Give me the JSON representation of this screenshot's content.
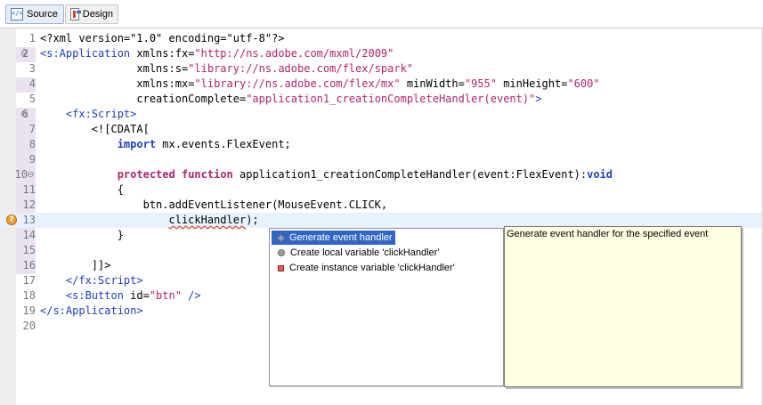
{
  "toolbar": {
    "tabs": [
      {
        "label": "Source",
        "icon": "source-code-icon",
        "active": true
      },
      {
        "label": "Design",
        "icon": "design-view-icon",
        "active": false
      }
    ]
  },
  "editor": {
    "current_line": 13,
    "lines": [
      {
        "n": "1"
      },
      {
        "n": "2"
      },
      {
        "n": "3"
      },
      {
        "n": "4"
      },
      {
        "n": "5"
      },
      {
        "n": "6"
      },
      {
        "n": "7"
      },
      {
        "n": "8"
      },
      {
        "n": "9"
      },
      {
        "n": "10"
      },
      {
        "n": "11"
      },
      {
        "n": "12"
      },
      {
        "n": "13"
      },
      {
        "n": "14"
      },
      {
        "n": "15"
      },
      {
        "n": "16"
      },
      {
        "n": "17"
      },
      {
        "n": "18"
      },
      {
        "n": "19"
      },
      {
        "n": "20"
      }
    ],
    "code": {
      "l1": "<?xml version=\"1.0\" encoding=\"utf-8\"?>",
      "l2_tag": "<s:Application",
      "l2_attr": " xmlns:fx=",
      "l2_val": "\"http://ns.adobe.com/mxml/2009\"",
      "l3_indent": "               ",
      "l3_attr": "xmlns:s=",
      "l3_val": "\"library://ns.adobe.com/flex/spark\"",
      "l4_indent": "               ",
      "l4_attr": "xmlns:mx=",
      "l4_val": "\"library://ns.adobe.com/flex/mx\"",
      "l4_attr2": " minWidth=",
      "l4_val2": "\"955\"",
      "l4_attr3": " minHeight=",
      "l4_val3": "\"600\"",
      "l5_indent": "               ",
      "l5_attr": "creationComplete=",
      "l5_val": "\"application1_creationCompleteHandler(event)\"",
      "l5_close": ">",
      "l6_tag": "    <fx:Script>",
      "l7": "        <![CDATA[",
      "l8_indent": "            ",
      "l8_kw": "import",
      "l8_rest": " mx.events.FlexEvent;",
      "l10_indent": "            ",
      "l10_kw": "protected",
      "l10_sp": " ",
      "l10_fn": "function",
      "l10_rest": " application1_creationCompleteHandler(event:FlexEvent):",
      "l10_void": "void",
      "l11": "            {",
      "l12": "                btn.addEventListener(MouseEvent.CLICK,",
      "l13_indent": "                    ",
      "l13_err": "clickHandler",
      "l13_rest": ");",
      "l14": "            }",
      "l16": "        ]]>",
      "l17_tag": "    </fx:Script>",
      "l18_tag": "    <s:Button",
      "l18_attr": " id=",
      "l18_val": "\"btn\"",
      "l18_close": " />",
      "l19_tag": "</s:Application>"
    }
  },
  "quickfix": {
    "items": [
      {
        "label": "Generate event handler",
        "icon": "method-diamond-icon",
        "selected": true
      },
      {
        "label": "Create local variable 'clickHandler'",
        "icon": "local-variable-icon",
        "selected": false
      },
      {
        "label": "Create instance variable 'clickHandler'",
        "icon": "instance-variable-icon",
        "selected": false
      }
    ]
  },
  "tooltip": {
    "text": "Generate event handler for the specified event"
  },
  "colors": {
    "tag": "#1f3fbf",
    "string": "#b0246e",
    "selection": "#3166c5",
    "tooltip_bg": "#ffffe1",
    "current_line": "#e8f2fe"
  }
}
